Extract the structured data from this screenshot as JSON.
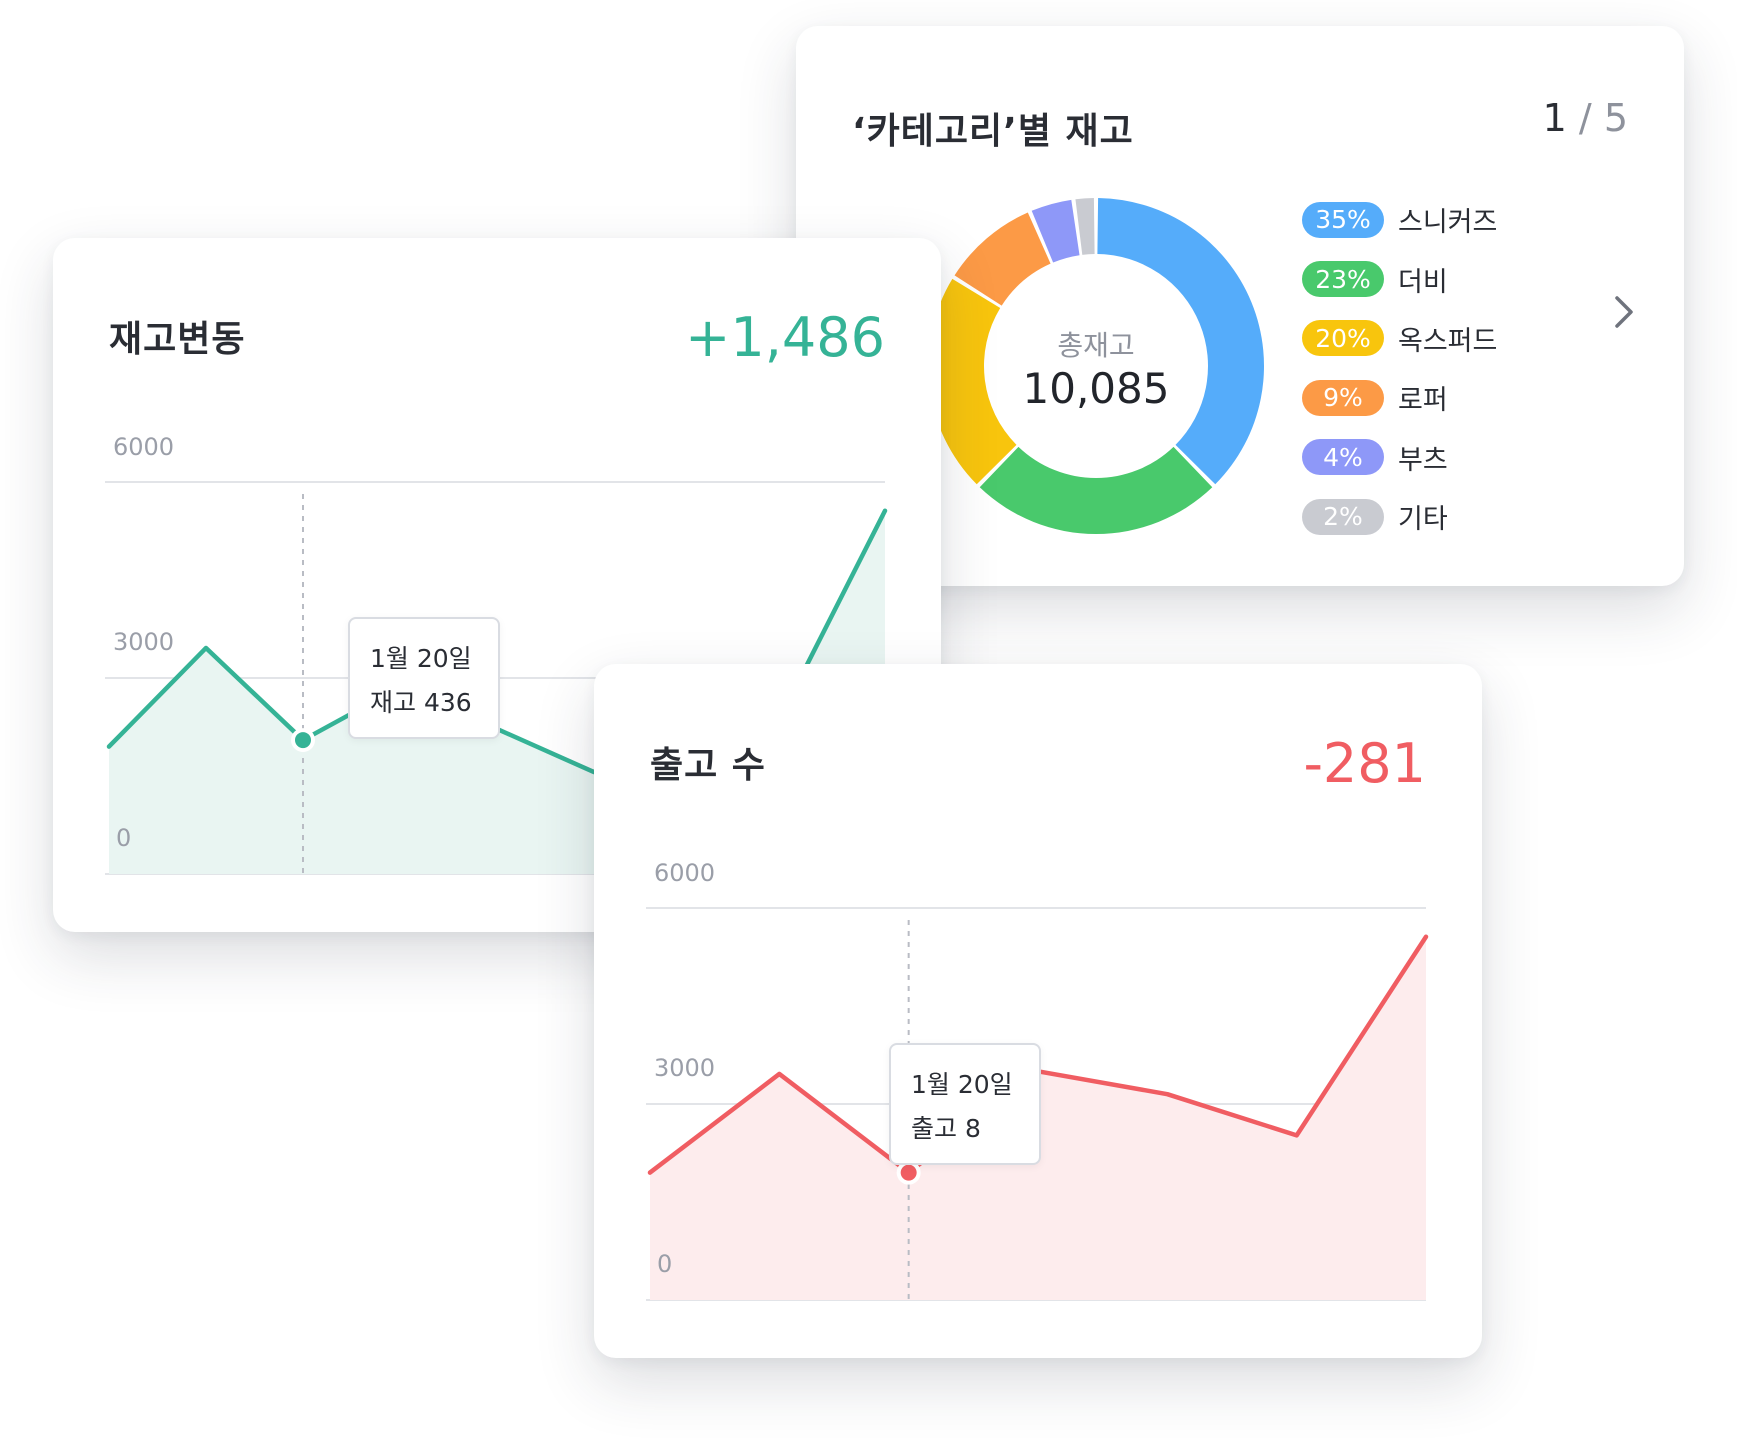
{
  "category_card": {
    "title": "‘카테고리’별 재고",
    "pager": {
      "current": "1",
      "separator": "/",
      "total": "5"
    },
    "center_label": "총재고",
    "center_value": "10,085",
    "items": [
      {
        "pct_label": "35%",
        "label": "스니커즈",
        "value": 35,
        "color": "#55acfa"
      },
      {
        "pct_label": "23%",
        "label": "더비",
        "value": 23,
        "color": "#49c96c"
      },
      {
        "pct_label": "20%",
        "label": "옥스퍼드",
        "value": 20,
        "color": "#f8c50d"
      },
      {
        "pct_label": "9%",
        "label": "로퍼",
        "value": 9,
        "color": "#fc9a46"
      },
      {
        "pct_label": "4%",
        "label": "부츠",
        "value": 4,
        "color": "#8e98f8"
      },
      {
        "pct_label": "2%",
        "label": "기타",
        "value": 2,
        "color": "#c9cbd1"
      }
    ],
    "next_icon": "chevron-right-icon"
  },
  "stock_card": {
    "title": "재고변동",
    "change": "+1,486",
    "color": "#35b396",
    "fill": "#e9f5f2",
    "y_ticks": [
      "6000",
      "3000",
      "0"
    ],
    "tooltip": {
      "date": "1월 20일",
      "value": "재고 436"
    }
  },
  "ship_card": {
    "title": "출고 수",
    "change": "-281",
    "color": "#f05d62",
    "fill": "#fdeced",
    "y_ticks": [
      "6000",
      "3000",
      "0"
    ],
    "tooltip": {
      "date": "1월 20일",
      "value": "출고 8"
    }
  },
  "chart_data": [
    {
      "type": "area",
      "title": "재고변동",
      "ylim": [
        0,
        6000
      ],
      "y_ticks": [
        6000,
        3000,
        0
      ],
      "grid": true,
      "series": [
        {
          "values": [
            1950,
            3460,
            2050,
            2860,
            2220,
            1560,
            2740,
            2630,
            5560
          ]
        }
      ],
      "highlight_index": 2
    },
    {
      "type": "area",
      "title": "출고 수",
      "ylim": [
        0,
        6000
      ],
      "y_ticks": [
        6000,
        3000,
        0
      ],
      "grid": true,
      "series": [
        {
          "values": [
            1950,
            3460,
            1950,
            3500,
            3150,
            2520,
            5560
          ]
        }
      ],
      "highlight_index": 2
    }
  ]
}
